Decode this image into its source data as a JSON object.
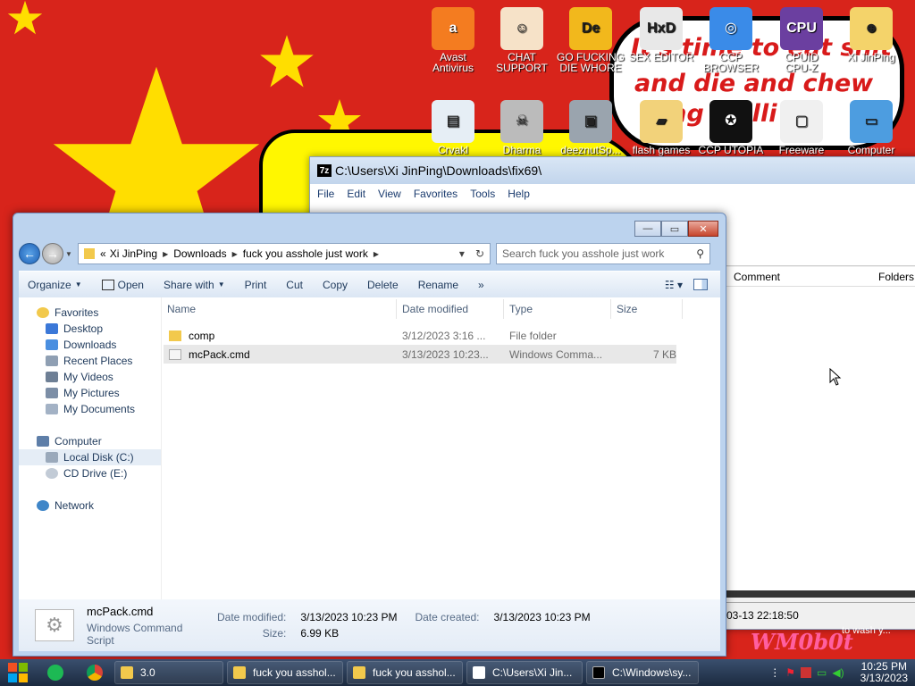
{
  "desktop": {
    "meme_lines": [
      "It's time to eat shit",
      "and die and chew",
      "ing chilli"
    ],
    "icons": [
      {
        "label": "Avast\nAntivirus",
        "icon": "avast-icon",
        "color": "#f47c20",
        "glyph": "a"
      },
      {
        "label": "CHAT\nSUPPORT",
        "icon": "support-agent-icon",
        "color": "#f6e2c8",
        "glyph": "☺"
      },
      {
        "label": "GO FUCKING\nDIE WHORE",
        "icon": "de-app-icon",
        "color": "#f2b81c",
        "glyph": "De"
      },
      {
        "label": "SEX EDITOR",
        "icon": "hxd-icon",
        "color": "#e8e8e8",
        "glyph": "HxD"
      },
      {
        "label": "CCP\nBROWSER",
        "icon": "browser-icon",
        "color": "#3a8be8",
        "glyph": "◎"
      },
      {
        "label": "CPUID\nCPU-Z",
        "icon": "cpuz-icon",
        "color": "#6b3fa0",
        "glyph": "CPU"
      },
      {
        "label": "Xi JinPing",
        "icon": "user-folder-icon",
        "color": "#f4d36a",
        "glyph": "☻"
      },
      {
        "label": "Crvakl",
        "icon": "notepad-icon",
        "color": "#e6eef5",
        "glyph": "▤"
      },
      {
        "label": "Dharma",
        "icon": "skull-icon",
        "color": "#bbbbbb",
        "glyph": "☠"
      },
      {
        "label": "deeznutSp...",
        "icon": "windows-stack-icon",
        "color": "#9aa4ae",
        "glyph": "▣"
      },
      {
        "label": "flash games",
        "icon": "folder-icon",
        "color": "#f2d27a",
        "glyph": "▰"
      },
      {
        "label": "CCP UTOPIA",
        "icon": "utopia-icon",
        "color": "#111111",
        "glyph": "✪"
      },
      {
        "label": "Freeware",
        "icon": "doc-icon",
        "color": "#f0f0f0",
        "glyph": "▢"
      },
      {
        "label": "Computer",
        "icon": "computer-icon",
        "color": "#4d9de0",
        "glyph": "▭"
      }
    ]
  },
  "zip_window": {
    "title": "C:\\Users\\Xi JinPing\\Downloads\\fix69\\",
    "app_badge": "7z",
    "menu": [
      "File",
      "Edit",
      "View",
      "Favorites",
      "Tools",
      "Help"
    ],
    "columns": [
      "Comment",
      "Folders"
    ],
    "status": "03-13 22:18:50",
    "overlay_text": "to wash y...",
    "logo_text": "WM0b0t"
  },
  "explorer": {
    "controls": {
      "min": "—",
      "max": "▭",
      "close": "✕"
    },
    "address": {
      "chevron": "«",
      "parts": [
        "Xi JinPing",
        "Downloads",
        "fuck you asshole just work"
      ]
    },
    "search_placeholder": "Search fuck you asshole just work",
    "commands": [
      "Organize",
      "Open",
      "Share with",
      "Print",
      "Cut",
      "Copy",
      "Delete",
      "Rename",
      "»"
    ],
    "nav": {
      "favorites": {
        "label": "Favorites",
        "items": [
          "Desktop",
          "Downloads",
          "Recent Places",
          "My Videos",
          "My Pictures",
          "My Documents"
        ]
      },
      "computer": {
        "label": "Computer",
        "items": [
          "Local Disk (C:)",
          "CD Drive (E:)"
        ]
      },
      "network": {
        "label": "Network"
      }
    },
    "columns": [
      "Name",
      "Date modified",
      "Type",
      "Size"
    ],
    "files": [
      {
        "name": "comp",
        "date": "3/12/2023 3:16 ...",
        "type": "File folder",
        "size": "",
        "icon": "folder-icon"
      },
      {
        "name": "mcPack.cmd",
        "date": "3/13/2023 10:23...",
        "type": "Windows Comma...",
        "size": "7 KB",
        "icon": "cmd-script-icon"
      }
    ],
    "details": {
      "name": "mcPack.cmd",
      "kind": "Windows Command Script",
      "modified_label": "Date modified:",
      "modified": "3/13/2023 10:23 PM",
      "created_label": "Date created:",
      "created": "3/13/2023 10:23 PM",
      "size_label": "Size:",
      "size": "6.99 KB"
    }
  },
  "taskbar": {
    "tasks": [
      {
        "label": "3.0",
        "icon": "folder-icon",
        "color": "#f2c94c"
      },
      {
        "label": "fuck you asshol...",
        "icon": "folder-icon",
        "color": "#f2c94c"
      },
      {
        "label": "fuck you asshol...",
        "icon": "folder-icon",
        "color": "#f2c94c"
      },
      {
        "label": "C:\\Users\\Xi Jin...",
        "icon": "7zip-icon",
        "color": "#ffffff"
      },
      {
        "label": "C:\\Windows\\sy...",
        "icon": "cmd-icon",
        "color": "#000000"
      }
    ],
    "time": "10:25 PM",
    "date": "3/13/2023"
  }
}
